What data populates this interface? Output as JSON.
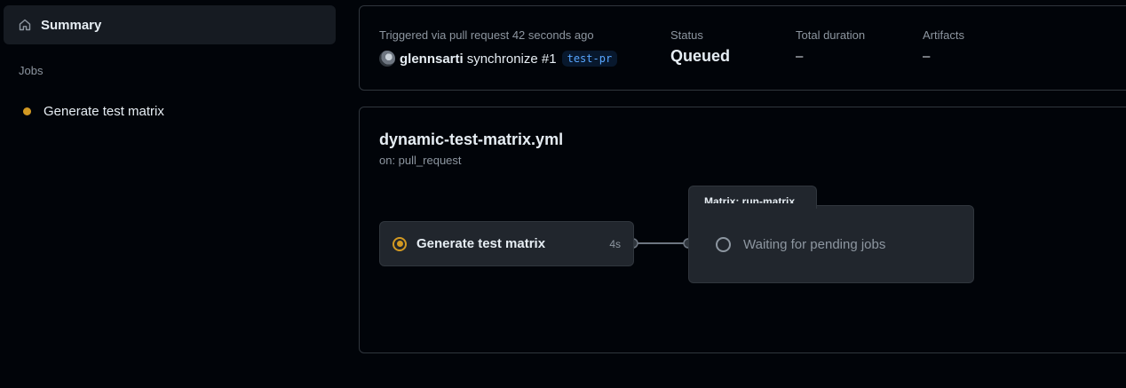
{
  "sidebar": {
    "summary_label": "Summary",
    "jobs_heading": "Jobs",
    "jobs": [
      {
        "label": "Generate test matrix",
        "status_color": "#d29922"
      }
    ]
  },
  "run_info": {
    "trigger_text": "Triggered via pull request 42 seconds ago",
    "actor": "glennsarti",
    "event": "synchronize #1",
    "branch": "test-pr",
    "status_label": "Status",
    "status_value": "Queued",
    "duration_label": "Total duration",
    "duration_value": "–",
    "artifacts_label": "Artifacts",
    "artifacts_value": "–"
  },
  "workflow": {
    "file": "dynamic-test-matrix.yml",
    "trigger": "on: pull_request",
    "job": {
      "label": "Generate test matrix",
      "duration": "4s",
      "status_color": "#d29922"
    },
    "matrix": {
      "title": "Matrix: run-matrix",
      "pending_label": "Waiting for pending jobs"
    }
  },
  "icons": {
    "summary": "home-icon",
    "job_status": "in-progress-icon",
    "pending": "pending-circle-icon"
  },
  "colors": {
    "accent": "#58a6ff",
    "in_progress": "#d29922",
    "muted": "#8d96a0"
  }
}
